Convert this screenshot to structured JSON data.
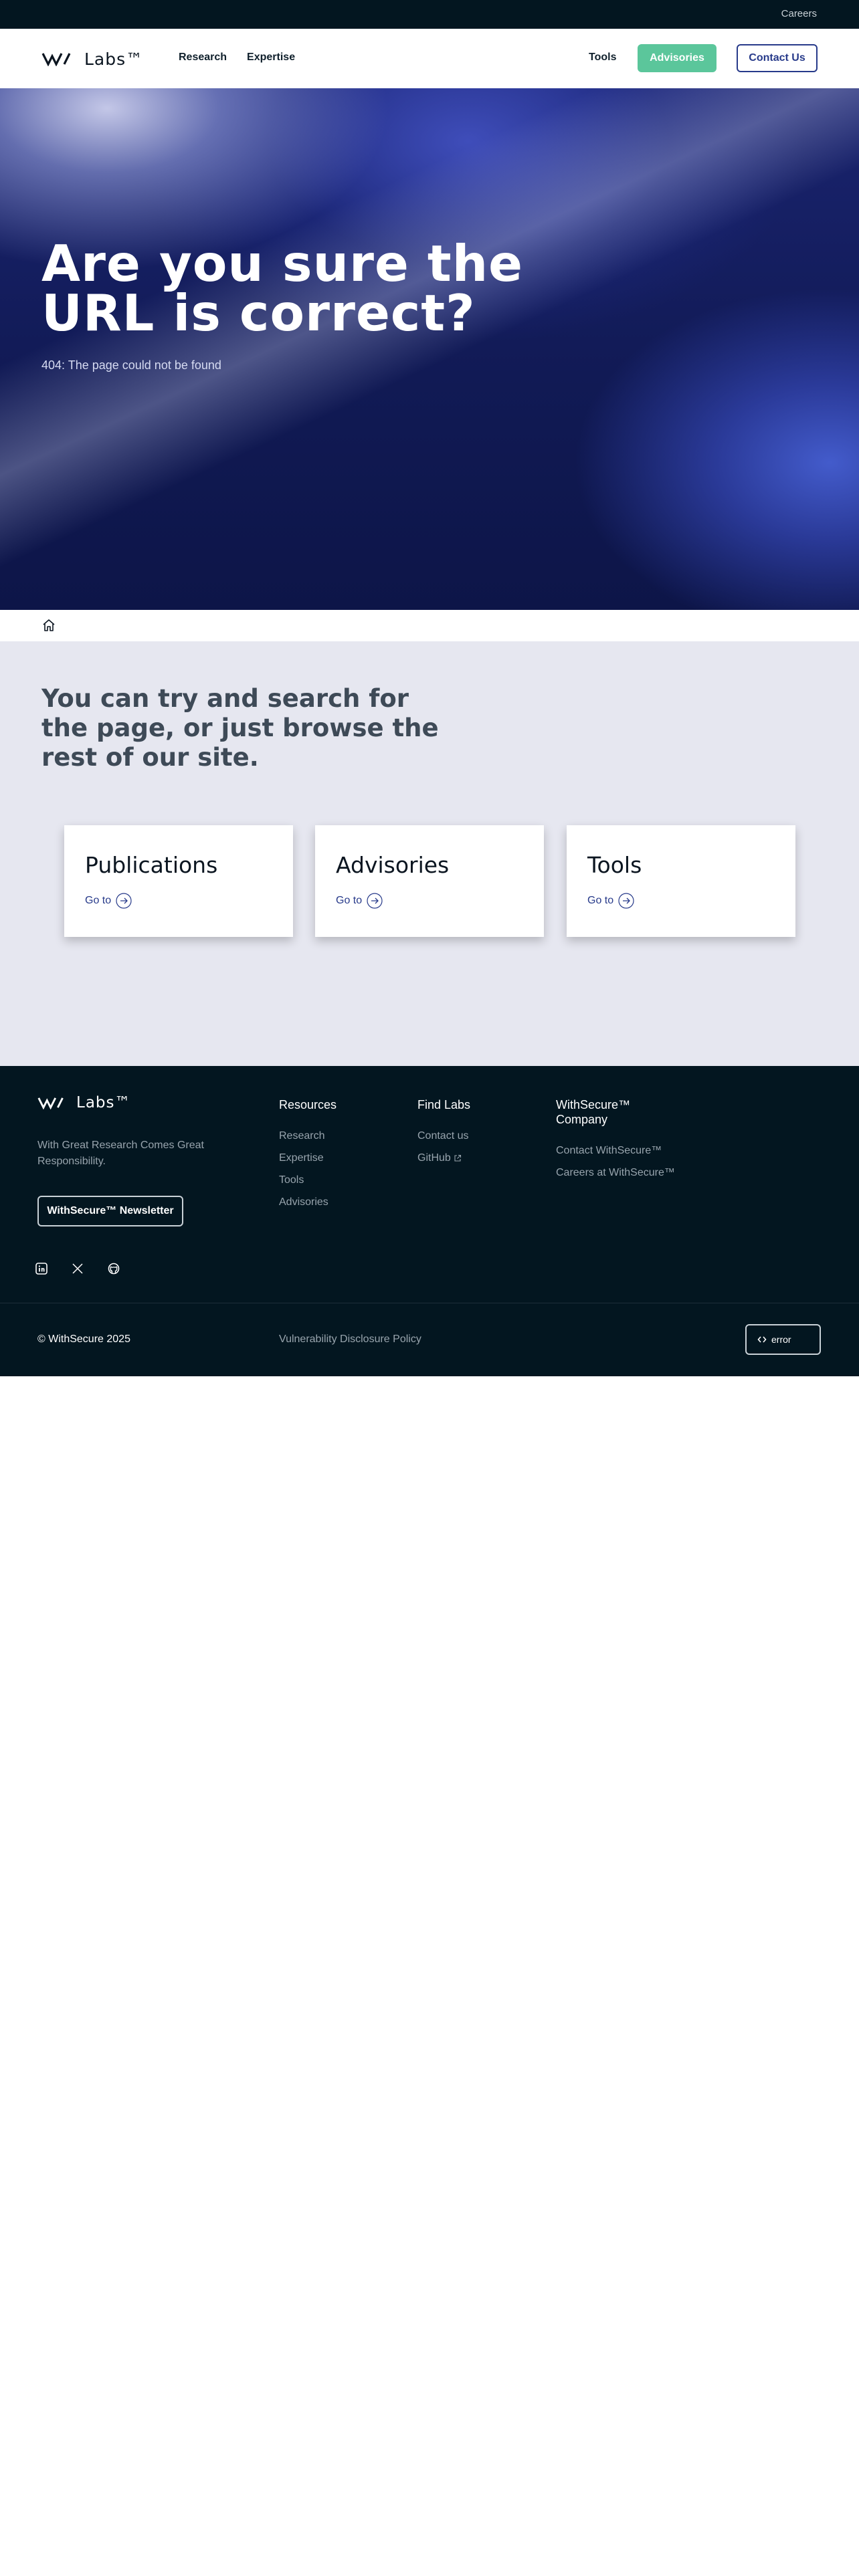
{
  "topbar": {
    "careers": "Careers"
  },
  "header": {
    "logo_text": "Labs™",
    "nav": [
      "Research",
      "Expertise"
    ],
    "tools": "Tools",
    "advisories_button": "Advisories",
    "contact_button": "Contact Us"
  },
  "hero": {
    "title": "Are you sure the URL is correct?",
    "subtitle": "404: The page could not be found"
  },
  "breadcrumb": {
    "icon": "home-icon"
  },
  "content": {
    "heading": "You can try and search for the page, or just browse the rest of our site.",
    "cards": [
      {
        "title": "Publications",
        "link": "Go to"
      },
      {
        "title": "Advisories",
        "link": "Go to"
      },
      {
        "title": "Tools",
        "link": "Go to"
      }
    ]
  },
  "footer": {
    "logo_text": "Labs™",
    "tagline": "With Great Research Comes Great Responsibility.",
    "newsletter_button": "WithSecure™ Newsletter",
    "columns": [
      {
        "heading": "Resources",
        "links": [
          "Research",
          "Expertise",
          "Tools",
          "Advisories"
        ]
      },
      {
        "heading": "Find Labs",
        "links": [
          "Contact us",
          "GitHub"
        ]
      },
      {
        "heading": "WithSecure™ Company",
        "links": [
          "Contact WithSecure™",
          "Careers at WithSecure™"
        ]
      }
    ],
    "social_icons": [
      "linkedin-icon",
      "x-icon",
      "github-icon"
    ],
    "copyright": "© WithSecure 2025",
    "vdp": "Vulnerability Disclosure Policy",
    "error_button": "error"
  },
  "colors": {
    "navy": "#031620",
    "accent_green": "#5bc69b",
    "accent_blue": "#273a8a",
    "content_bg": "#e6e7f0"
  }
}
